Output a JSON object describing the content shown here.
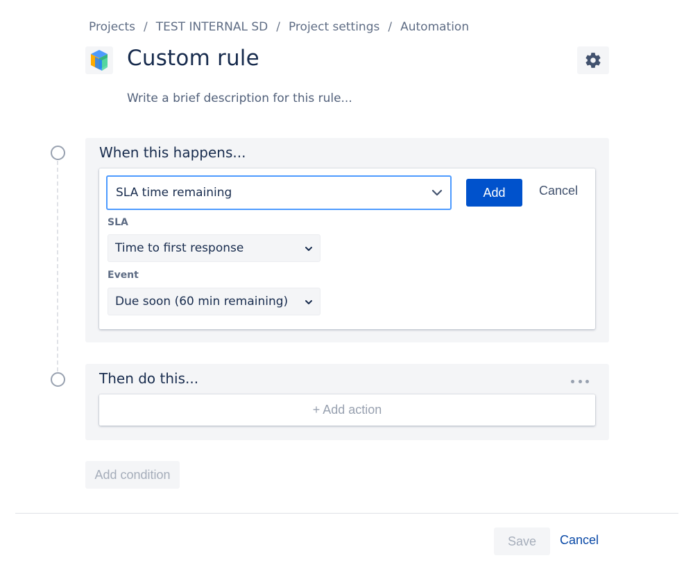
{
  "breadcrumb": {
    "items": [
      "Projects",
      "TEST INTERNAL SD",
      "Project settings",
      "Automation"
    ],
    "separator": "/"
  },
  "page": {
    "title": "Custom rule",
    "description_placeholder": "Write a brief description for this rule..."
  },
  "trigger": {
    "heading": "When this happens...",
    "selected": "SLA time remaining",
    "add_label": "Add",
    "cancel_label": "Cancel",
    "sla_label": "SLA",
    "sla_value": "Time to first response",
    "event_label": "Event",
    "event_value": "Due soon (60 min remaining)"
  },
  "action": {
    "heading": "Then do this...",
    "add_action_label": "+ Add action"
  },
  "add_condition_label": "Add condition",
  "footer": {
    "save_label": "Save",
    "cancel_label": "Cancel"
  },
  "colors": {
    "primary": "#0052cc",
    "focus_border": "#4c9aff",
    "panel_bg": "#f4f5f7",
    "text": "#172b4d",
    "link": "#0747a6"
  },
  "icons": {
    "rule": "cube-icon",
    "settings": "gear-icon",
    "chevron": "chevron-down-icon",
    "more": "more-horizontal-icon"
  }
}
